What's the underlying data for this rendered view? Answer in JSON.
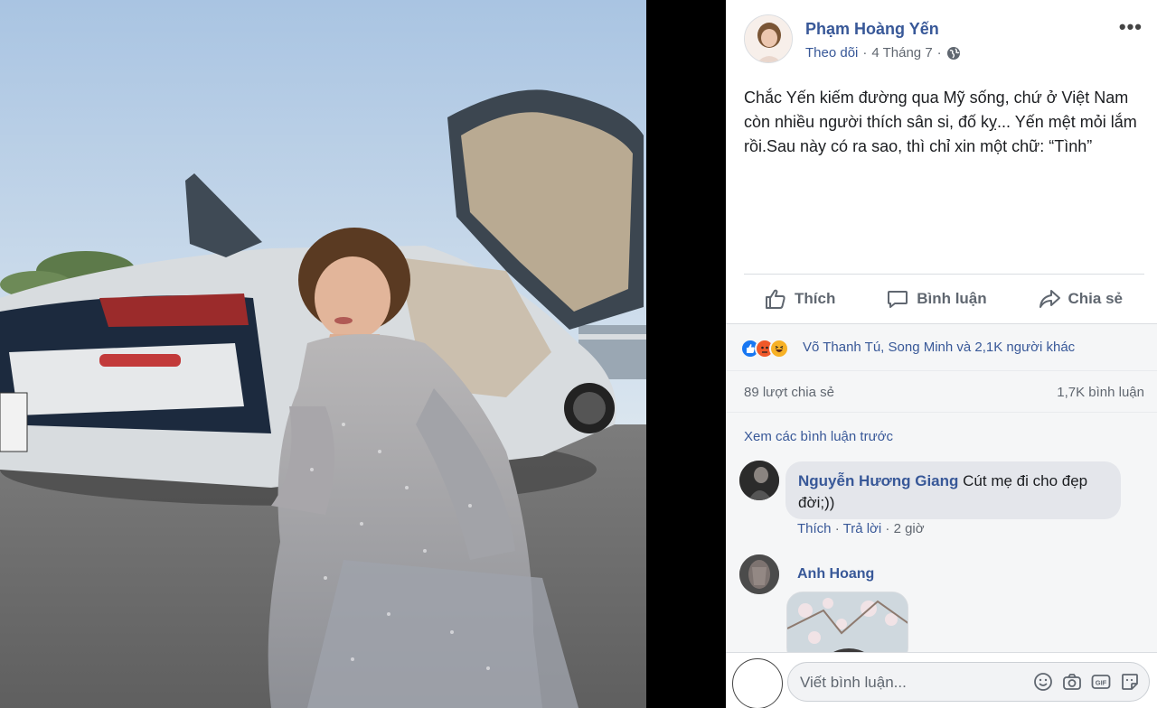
{
  "post": {
    "author": "Phạm Hoàng Yến",
    "follow_label": "Theo dõi",
    "date": "4 Tháng 7",
    "separator": "·",
    "more_label": "•••",
    "text": "Chắc Yến kiếm đường qua Mỹ sống, chứ ở Việt Nam còn nhiều người thích sân si, đố kỵ... Yến mệt mỏi lắm rồi.Sau này có ra sao, thì chỉ xin một chữ: “Tình”"
  },
  "actions": {
    "like": "Thích",
    "comment": "Bình luận",
    "share": "Chia sẻ"
  },
  "reactions": {
    "icons": [
      "like-icon",
      "angry-icon",
      "haha-icon"
    ],
    "summary": "Võ Thanh Tú, Song Minh và 2,1K người khác"
  },
  "counts": {
    "shares": "89 lượt chia sẻ",
    "comments": "1,7K bình luận"
  },
  "comments": {
    "view_previous": "Xem các bình luận trước",
    "items": [
      {
        "name": "Nguyễn Hương Giang",
        "text": "Cút mẹ đi cho đẹp đời;))",
        "like_label": "Thích",
        "reply_label": "Trả lời",
        "time": "2 giờ"
      },
      {
        "name": "Anh Hoang"
      }
    ]
  },
  "composer": {
    "placeholder": "Viết bình luận...",
    "icons": [
      "emoji-icon",
      "camera-icon",
      "gif-icon",
      "sticker-icon"
    ],
    "gif_label": "GIF"
  },
  "colors": {
    "link_blue": "#385898",
    "like_blue": "#1877f2",
    "angry_orange": "#f0592a",
    "haha_yellow": "#f7b125"
  }
}
